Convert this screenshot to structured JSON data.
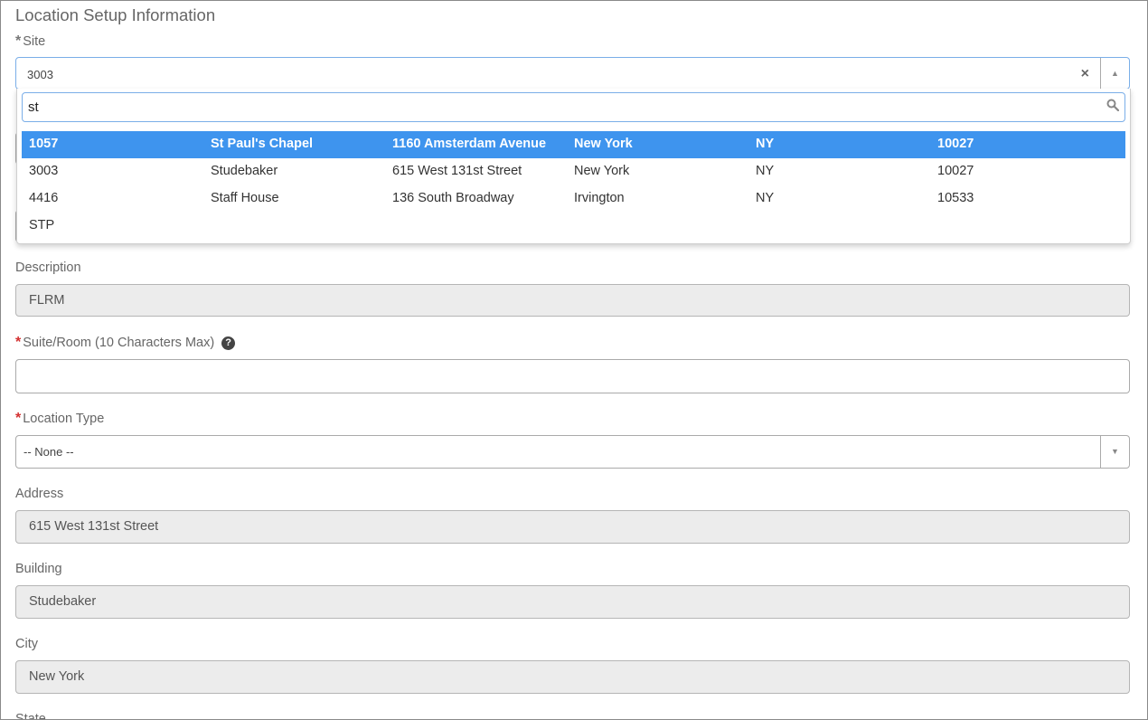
{
  "section_title": "Location Setup Information",
  "site": {
    "label": "Site",
    "value": "3003",
    "clear_glyph": "×",
    "arrow_glyph": "▲"
  },
  "site_dropdown": {
    "search_value": "st",
    "rows": [
      {
        "code": "1057",
        "name": "St Paul's Chapel",
        "address": "1160 Amsterdam Avenue",
        "city": "New York",
        "state": "NY",
        "zip": "10027",
        "highlighted": true
      },
      {
        "code": "3003",
        "name": "Studebaker",
        "address": "615 West 131st Street",
        "city": "New York",
        "state": "NY",
        "zip": "10027",
        "highlighted": false
      },
      {
        "code": "4416",
        "name": "Staff House",
        "address": "136 South Broadway",
        "city": "Irvington",
        "state": "NY",
        "zip": "10533",
        "highlighted": false
      },
      {
        "code": "STP",
        "name": "",
        "address": "",
        "city": "",
        "state": "",
        "zip": "",
        "highlighted": false
      }
    ]
  },
  "description": {
    "label": "Description",
    "value": "FLRM"
  },
  "suite_room": {
    "label": "Suite/Room (10 Characters Max)",
    "value": "",
    "help_glyph": "?"
  },
  "location_type": {
    "label": "Location Type",
    "value": "-- None --",
    "arrow_glyph": "▼"
  },
  "address": {
    "label": "Address",
    "value": "615 West 131st Street"
  },
  "building": {
    "label": "Building",
    "value": "Studebaker"
  },
  "city": {
    "label": "City",
    "value": "New York"
  },
  "state": {
    "label": "State"
  },
  "required_marker": "*",
  "colors": {
    "accent": "#3e94ee",
    "required": "#d32f2f",
    "readonly_bg": "#ececec"
  }
}
